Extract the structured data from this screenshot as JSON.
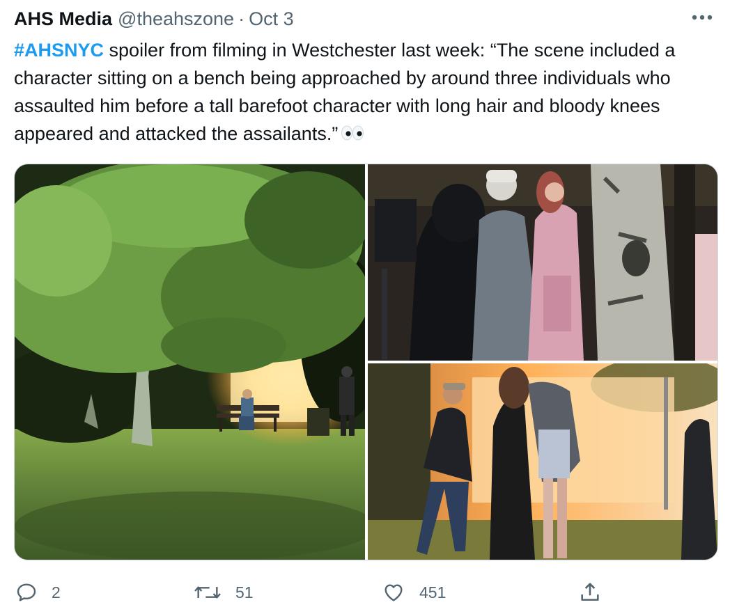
{
  "tweet": {
    "author_name": "AHS Media",
    "handle": "@theahszone",
    "separator": "·",
    "date": "Oct 3",
    "hashtag": "#AHSNYC",
    "text": " spoiler from filming in Westchester last week: “The scene included a character sitting on a bench being approached by around three individuals who assaulted him before a tall barefoot character with long hair and bloody knees appeared and attacked the assailants.”",
    "emoji_icon": "eyes-emoji-icon"
  },
  "media": {
    "photos": [
      {
        "name": "park-bench-night-photo"
      },
      {
        "name": "film-crew-and-tree-photo"
      },
      {
        "name": "actors-walking-photo"
      }
    ]
  },
  "actions": {
    "reply_count": "2",
    "retweet_count": "51",
    "like_count": "451",
    "icons": [
      "reply-icon",
      "retweet-icon",
      "like-icon",
      "share-icon"
    ]
  },
  "colors": {
    "text": "#0f1419",
    "secondary": "#536471",
    "hashtag": "#1d9bf0",
    "border": "#cfd9de"
  }
}
